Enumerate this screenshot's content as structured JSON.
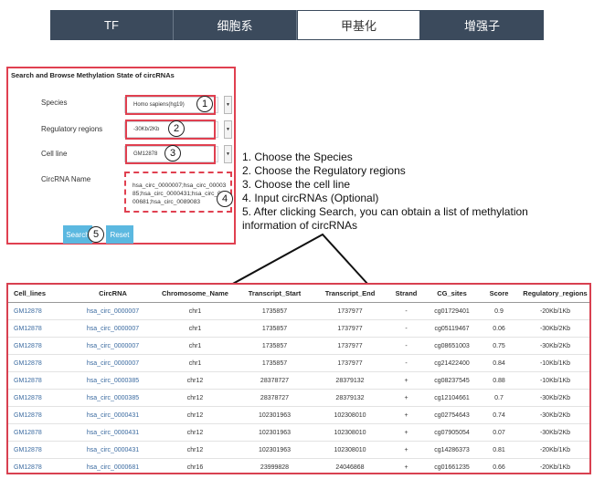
{
  "tabs": [
    {
      "label": "TF",
      "active": false
    },
    {
      "label": "细胞系",
      "active": false
    },
    {
      "label": "甲基化",
      "active": true
    },
    {
      "label": "增强子",
      "active": false
    }
  ],
  "search_form": {
    "title": "Search and Browse Methylation State of circRNAs",
    "species": {
      "label": "Species",
      "value": "Homo sapiens(hg19)"
    },
    "regulatory_regions": {
      "label": "Regulatory regions",
      "value": "-30Kb/2Kb"
    },
    "cell_line": {
      "label": "Cell line",
      "value": "GM12878"
    },
    "circrna_name": {
      "label": "CircRNA Name",
      "value": "hsa_circ_0000007;hsa_circ_0000385;hsa_circ_0000431;hsa_circ_0000681;hsa_circ_0089083"
    },
    "search_button": "Search",
    "reset_button": "Reset",
    "dropdown_arrow": "▼",
    "markers": [
      "1",
      "2",
      "3",
      "4",
      "5"
    ]
  },
  "instructions": [
    "1. Choose the Species",
    "2. Choose the Regulatory regions",
    "3. Choose the cell line",
    "4. Input circRNAs (Optional)",
    "5. After clicking Search, you can obtain a list of methylation",
    "information of circRNAs"
  ],
  "table": {
    "columns": [
      "Cell_lines",
      "CircRNA",
      "Chromosome_Name",
      "Transcript_Start",
      "Transcript_End",
      "Strand",
      "CG_sites",
      "Score",
      "Regulatory_regions"
    ],
    "rows": [
      [
        "GM12878",
        "hsa_circ_0000007",
        "chr1",
        "1735857",
        "1737977",
        "-",
        "cg01729401",
        "0.9",
        "-20Kb/1Kb"
      ],
      [
        "GM12878",
        "hsa_circ_0000007",
        "chr1",
        "1735857",
        "1737977",
        "-",
        "cg05119467",
        "0.06",
        "-30Kb/2Kb"
      ],
      [
        "GM12878",
        "hsa_circ_0000007",
        "chr1",
        "1735857",
        "1737977",
        "-",
        "cg08651003",
        "0.75",
        "-30Kb/2Kb"
      ],
      [
        "GM12878",
        "hsa_circ_0000007",
        "chr1",
        "1735857",
        "1737977",
        "-",
        "cg21422400",
        "0.84",
        "-10Kb/1Kb"
      ],
      [
        "GM12878",
        "hsa_circ_0000385",
        "chr12",
        "28378727",
        "28379132",
        "+",
        "cg08237545",
        "0.88",
        "-10Kb/1Kb"
      ],
      [
        "GM12878",
        "hsa_circ_0000385",
        "chr12",
        "28378727",
        "28379132",
        "+",
        "cg12104661",
        "0.7",
        "-30Kb/2Kb"
      ],
      [
        "GM12878",
        "hsa_circ_0000431",
        "chr12",
        "102301963",
        "102308010",
        "+",
        "cg02754643",
        "0.74",
        "-30Kb/2Kb"
      ],
      [
        "GM12878",
        "hsa_circ_0000431",
        "chr12",
        "102301963",
        "102308010",
        "+",
        "cg07905054",
        "0.07",
        "-30Kb/2Kb"
      ],
      [
        "GM12878",
        "hsa_circ_0000431",
        "chr12",
        "102301963",
        "102308010",
        "+",
        "cg14286373",
        "0.81",
        "-20Kb/1Kb"
      ],
      [
        "GM12878",
        "hsa_circ_0000681",
        "chr16",
        "23999828",
        "24046868",
        "+",
        "cg01661235",
        "0.66",
        "-20Kb/1Kb"
      ]
    ]
  }
}
